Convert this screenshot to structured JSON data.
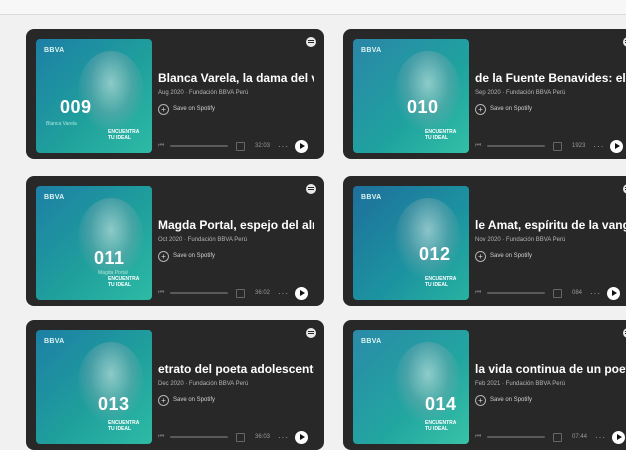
{
  "brand": "BBVA",
  "series_label": "ENCUENTRA TU IDEAL",
  "save_label": "Save on Spotify",
  "cards": [
    {
      "num": "009",
      "title": "Blanca Varela, la dama del ve",
      "meta": "Aug 2020 · Fundación BBVA Perú",
      "time": "32:03",
      "name": "Blanca Varela"
    },
    {
      "num": "010",
      "title": "de la Fuente Benavides: el",
      "meta": "Sep 2020 · Fundación BBVA Perú",
      "time": "1923"
    },
    {
      "num": "011",
      "title": "Magda Portal, espejo del alm",
      "meta": "Oct 2020 · Fundación BBVA Perú",
      "time": "36:02",
      "name": "Magda Portal"
    },
    {
      "num": "012",
      "title": "le Amat, espíritu de la vang",
      "meta": "Nov 2020 · Fundación BBVA Perú",
      "time": "084"
    },
    {
      "num": "013",
      "title": "etrato del poeta adolescente",
      "meta": "Dec 2020 · Fundación BBVA Perú",
      "time": "36:03"
    },
    {
      "num": "014",
      "title": "la vida continua de un poet",
      "meta": "Feb 2021 · Fundación BBVA Perú",
      "time": "07:44"
    }
  ]
}
